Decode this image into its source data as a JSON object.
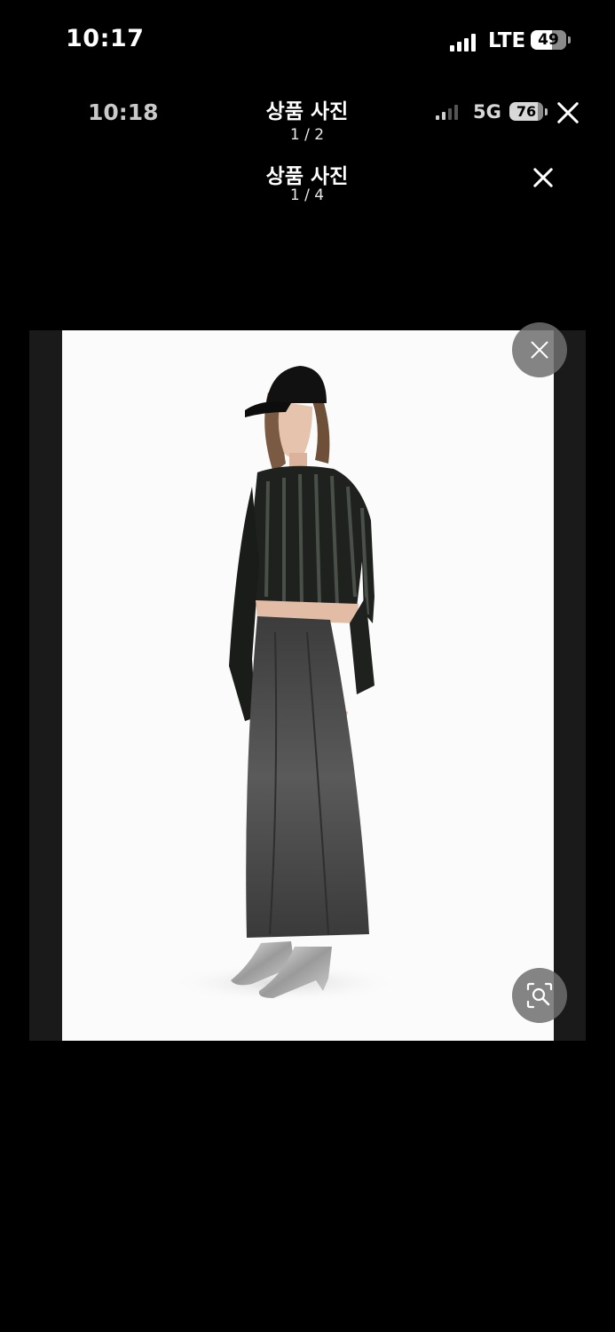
{
  "status_bar": {
    "time": "10:17",
    "network": "LTE",
    "battery": "49"
  },
  "inner_status_bar": {
    "time": "10:18",
    "network": "5G",
    "battery": "76"
  },
  "viewer_header_1": {
    "title": "상품 사진",
    "counter": "1 / 2"
  },
  "viewer_header_2": {
    "title": "상품 사진",
    "counter": "1 / 4"
  },
  "icons": {
    "close": "close-icon",
    "search_image": "image-search-icon",
    "signal": "signal-icon",
    "battery": "battery-icon"
  },
  "colors": {
    "background": "#000000",
    "photo_background": "#fbfbfb",
    "overlay_button": "#6e6e6e"
  }
}
